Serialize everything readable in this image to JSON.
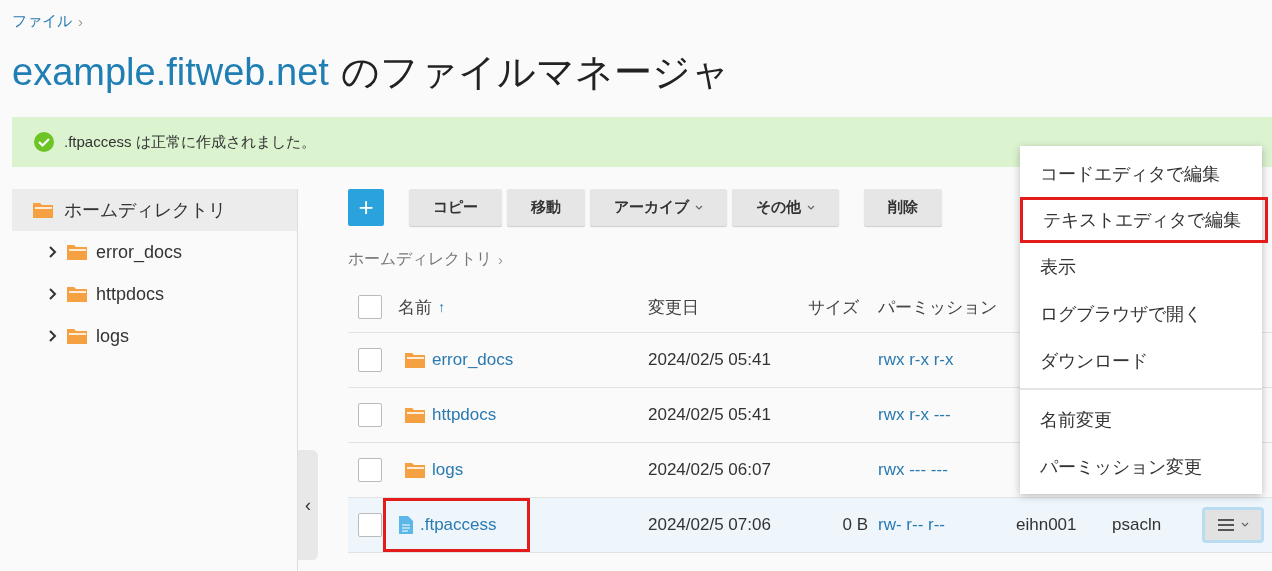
{
  "breadcrumb": [
    {
      "label": "ファイル",
      "separator": "›"
    }
  ],
  "title": {
    "domain": "example.fitweb.net",
    "suffix": "のファイルマネージャ"
  },
  "alert": {
    "kind": "success",
    "message": ".ftpaccess は正常に作成されました。"
  },
  "sidebar": {
    "root": {
      "label": "ホームディレクトリ",
      "selected": true,
      "children": [
        {
          "label": "error_docs",
          "expanded": false
        },
        {
          "label": "httpdocs",
          "expanded": false
        },
        {
          "label": "logs",
          "expanded": false
        }
      ]
    },
    "collapse_label": "‹"
  },
  "toolbar": [
    {
      "kind": "add",
      "label": "+"
    },
    {
      "kind": "plain",
      "label": "コピー"
    },
    {
      "kind": "plain",
      "label": "移動"
    },
    {
      "kind": "dropdown",
      "label": "アーカイブ"
    },
    {
      "kind": "dropdown",
      "label": "その他"
    },
    {
      "kind": "plain",
      "label": "削除"
    }
  ],
  "path": [
    {
      "label": "ホームディレクトリ",
      "separator": "›"
    }
  ],
  "table": {
    "all_checked": false,
    "columns": [
      {
        "label": "名前",
        "sort": "↑"
      },
      {
        "label": "変更日"
      },
      {
        "label": "サイズ"
      },
      {
        "label": "パーミッション"
      }
    ],
    "rows": [
      {
        "kind": "folder",
        "name": "error_docs",
        "modified": "2024/02/5 05:41",
        "size": "",
        "permissions": "rwx r-x r-x",
        "user": "",
        "group": "",
        "checked": false,
        "hovered": false,
        "highlighted": false
      },
      {
        "kind": "folder",
        "name": "httpdocs",
        "modified": "2024/02/5 05:41",
        "size": "",
        "permissions": "rwx r-x ---",
        "user": "",
        "group": "",
        "checked": false,
        "hovered": false,
        "highlighted": false
      },
      {
        "kind": "folder",
        "name": "logs",
        "modified": "2024/02/5 06:07",
        "size": "",
        "permissions": "rwx --- ---",
        "user": "",
        "group": "",
        "checked": false,
        "hovered": false,
        "highlighted": false
      },
      {
        "kind": "file",
        "name": ".ftpaccess",
        "modified": "2024/02/5 07:06",
        "size": "0 B",
        "permissions": "rw- r-- r--",
        "user": "eihn001",
        "group": "psacln",
        "checked": false,
        "hovered": true,
        "highlighted": true
      }
    ]
  },
  "context_menu": {
    "groups": [
      [
        {
          "label": "コードエディタで編集",
          "highlighted": false
        },
        {
          "label": "テキストエディタで編集",
          "highlighted": true
        },
        {
          "label": "表示",
          "highlighted": false
        },
        {
          "label": "ログブラウザで開く",
          "highlighted": false
        },
        {
          "label": "ダウンロード",
          "highlighted": false
        }
      ],
      [
        {
          "label": "名前変更",
          "highlighted": false
        },
        {
          "label": "パーミッション変更",
          "highlighted": false
        }
      ]
    ]
  }
}
